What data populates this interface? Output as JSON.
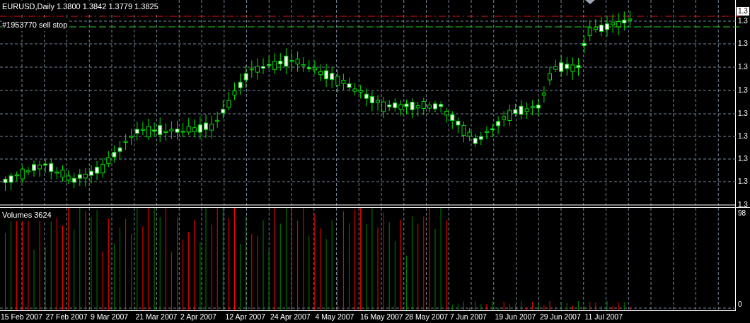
{
  "chart_header": "EURUSD,Daily  1.3800 1.3842 1.3779 1.3825",
  "order_label": "#1953770 sell stop",
  "current_price_label": "1.3",
  "price_axis": [
    "1.3",
    "1.3",
    "1.3",
    "1.3",
    "1.3",
    "1.3",
    "1.3",
    "1.3",
    "1.3"
  ],
  "volume_pane": {
    "title": "Volumes 3624",
    "axis": [
      "98",
      "0"
    ]
  },
  "date_axis": [
    "15 Feb 2007",
    "27 Feb 2007",
    "9 Mar 2007",
    "21 Mar 2007",
    "2 Apr 2007",
    "12 Apr 2007",
    "24 Apr 2007",
    "4 May 2007",
    "16 May 2007",
    "28 May 2007",
    "7 Jun 2007",
    "19 Jun 2007",
    "29 Jun 2007",
    "11 Jul 2007"
  ]
}
